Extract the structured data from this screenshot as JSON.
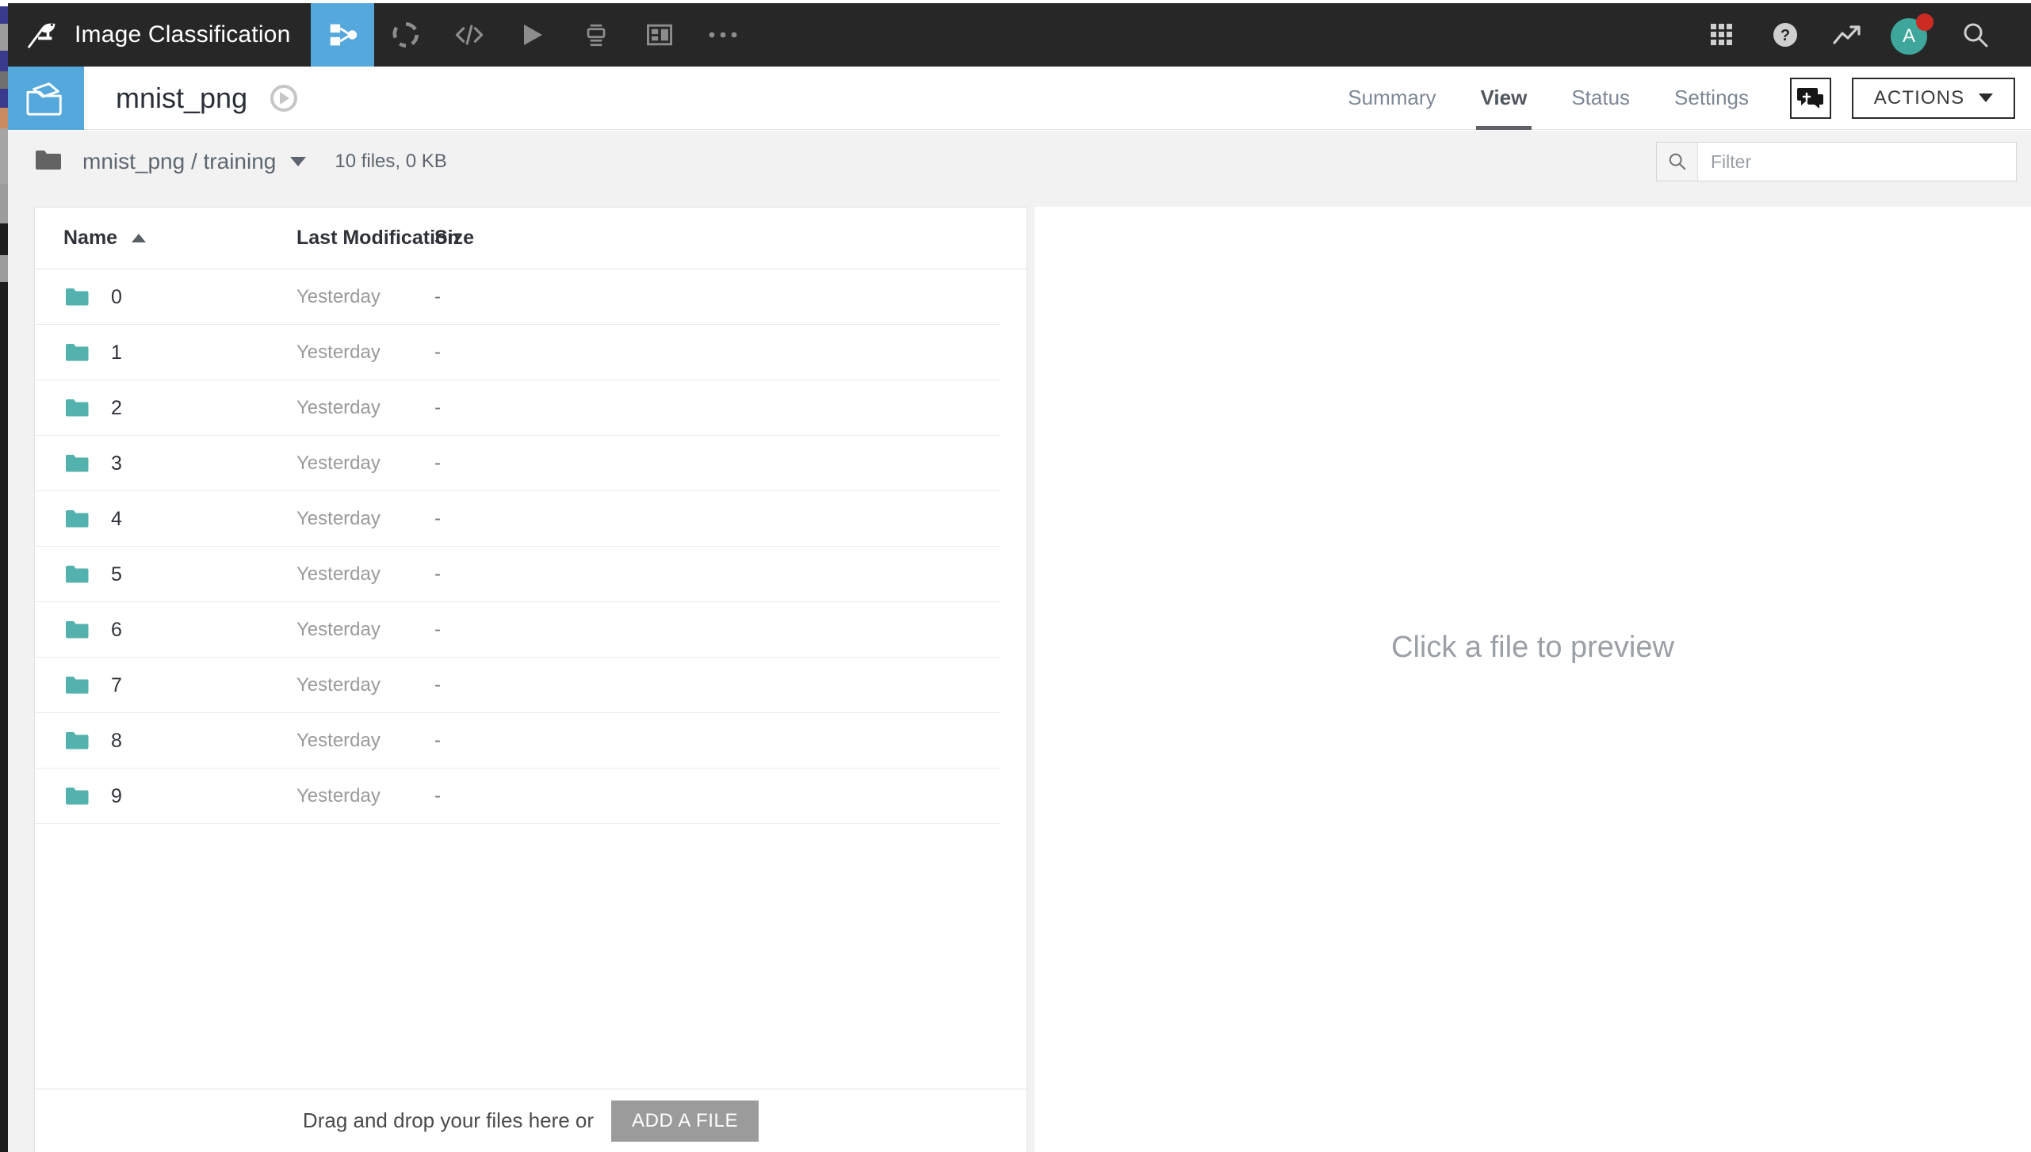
{
  "topbar": {
    "app_title": "Image Classification",
    "logo_icon": "bird-logo-icon",
    "tools": [
      {
        "name": "flow-icon",
        "label": "Flow",
        "active": true
      },
      {
        "name": "lab-icon",
        "label": "Lab",
        "active": false
      },
      {
        "name": "code-icon",
        "label": "Code",
        "active": false
      },
      {
        "name": "run-icon",
        "label": "Run",
        "active": false
      },
      {
        "name": "jobs-icon",
        "label": "Jobs",
        "active": false
      },
      {
        "name": "dashboard-icon",
        "label": "Dashboards",
        "active": false
      },
      {
        "name": "more-icon",
        "label": "More",
        "active": false
      }
    ],
    "right_icons": [
      {
        "name": "apps-grid-icon",
        "label": "Apps"
      },
      {
        "name": "help-icon",
        "label": "Help"
      },
      {
        "name": "activity-icon",
        "label": "Activity"
      }
    ],
    "avatar": {
      "name": "avatar",
      "initial": "A",
      "color": "#3ea69b",
      "badge_color": "#cc2b22"
    },
    "search_icon": "search-icon"
  },
  "dataset_header": {
    "icon": "dataset-folder-icon",
    "icon_bg": "#55a8dc",
    "name": "mnist_png",
    "build_status_icon": "build-status-icon",
    "tabs": [
      {
        "label": "Summary",
        "active": false
      },
      {
        "label": "View",
        "active": true
      },
      {
        "label": "Status",
        "active": false
      },
      {
        "label": "Settings",
        "active": false
      }
    ],
    "discussion_icon": "discussion-add-icon",
    "actions_label": "ACTIONS"
  },
  "breadcrumb": {
    "folder_icon": "folder-icon",
    "path": "mnist_png / training",
    "stats": "10 files, 0 KB"
  },
  "filter": {
    "icon": "search-icon",
    "placeholder": "Filter",
    "value": ""
  },
  "table": {
    "columns": [
      {
        "key": "name",
        "label": "Name",
        "sort": "asc"
      },
      {
        "key": "modified",
        "label": "Last Modification"
      },
      {
        "key": "size",
        "label": "Size"
      }
    ],
    "rows": [
      {
        "icon": "folder-icon",
        "name": "0",
        "modified": "Yesterday",
        "size": "-"
      },
      {
        "icon": "folder-icon",
        "name": "1",
        "modified": "Yesterday",
        "size": "-"
      },
      {
        "icon": "folder-icon",
        "name": "2",
        "modified": "Yesterday",
        "size": "-"
      },
      {
        "icon": "folder-icon",
        "name": "3",
        "modified": "Yesterday",
        "size": "-"
      },
      {
        "icon": "folder-icon",
        "name": "4",
        "modified": "Yesterday",
        "size": "-"
      },
      {
        "icon": "folder-icon",
        "name": "5",
        "modified": "Yesterday",
        "size": "-"
      },
      {
        "icon": "folder-icon",
        "name": "6",
        "modified": "Yesterday",
        "size": "-"
      },
      {
        "icon": "folder-icon",
        "name": "7",
        "modified": "Yesterday",
        "size": "-"
      },
      {
        "icon": "folder-icon",
        "name": "8",
        "modified": "Yesterday",
        "size": "-"
      },
      {
        "icon": "folder-icon",
        "name": "9",
        "modified": "Yesterday",
        "size": "-"
      }
    ],
    "folder_color": "#54b2ae"
  },
  "dropzone": {
    "text": "Drag and drop your files here or",
    "button_label": "ADD A FILE"
  },
  "preview": {
    "placeholder": "Click a file to preview"
  },
  "colors": {
    "topbar_bg": "#272727",
    "accent_blue": "#55a8dc",
    "page_bg": "#f2f2f2",
    "teal": "#54b2ae"
  }
}
